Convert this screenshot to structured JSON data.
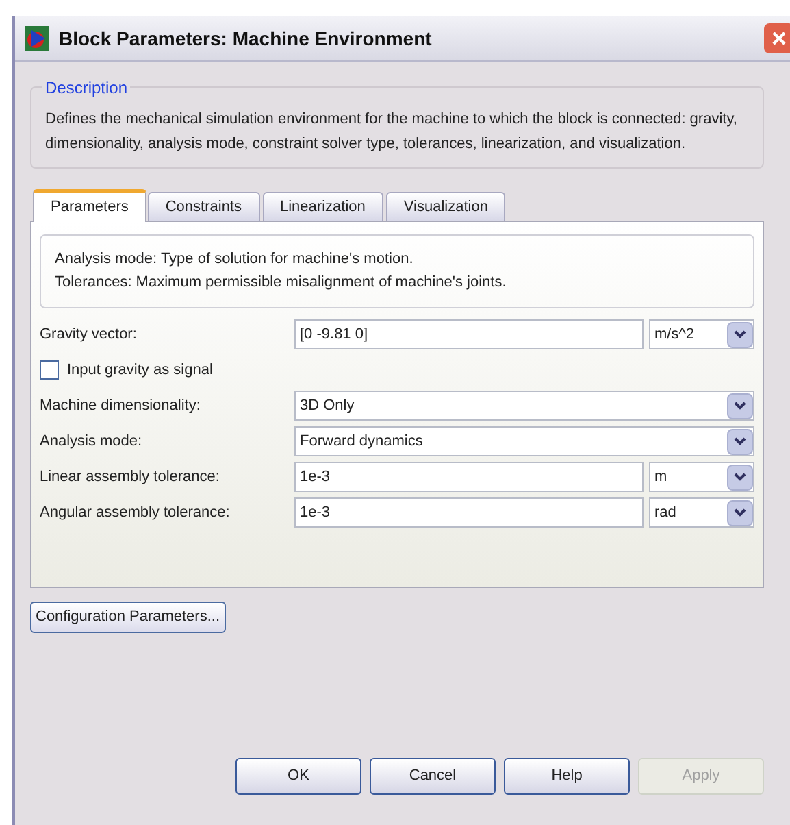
{
  "window": {
    "title": "Block Parameters: Machine Environment"
  },
  "description": {
    "title": "Description",
    "text": "Defines the mechanical simulation environment for the machine to which the block is connected: gravity, dimensionality, analysis mode, constraint solver type, tolerances, linearization, and visualization."
  },
  "tabs": [
    {
      "label": "Parameters",
      "selected": true
    },
    {
      "label": "Constraints",
      "selected": false
    },
    {
      "label": "Linearization",
      "selected": false
    },
    {
      "label": "Visualization",
      "selected": false
    }
  ],
  "help_lines": [
    "Analysis mode: Type of solution for machine's motion.",
    "Tolerances: Maximum permissible misalignment of machine's joints."
  ],
  "parameters": [
    {
      "kind": "value_unit",
      "label": "Gravity vector:",
      "value": "[0 -9.81 0]",
      "unit": "m/s^2"
    },
    {
      "kind": "checkbox",
      "label": "Input gravity as signal",
      "checked": false
    },
    {
      "kind": "select",
      "label": "Machine dimensionality:",
      "value": "3D Only"
    },
    {
      "kind": "select",
      "label": "Analysis mode:",
      "value": "Forward dynamics"
    },
    {
      "kind": "value_unit",
      "label": "Linear assembly tolerance:",
      "value": "1e-3",
      "unit": "m"
    },
    {
      "kind": "value_unit",
      "label": "Angular assembly tolerance:",
      "value": "1e-3",
      "unit": "rad"
    }
  ],
  "config_button": "Configuration Parameters...",
  "buttons": [
    {
      "label": "OK",
      "disabled": false
    },
    {
      "label": "Cancel",
      "disabled": false
    },
    {
      "label": "Help",
      "disabled": false
    },
    {
      "label": "Apply",
      "disabled": true
    }
  ]
}
